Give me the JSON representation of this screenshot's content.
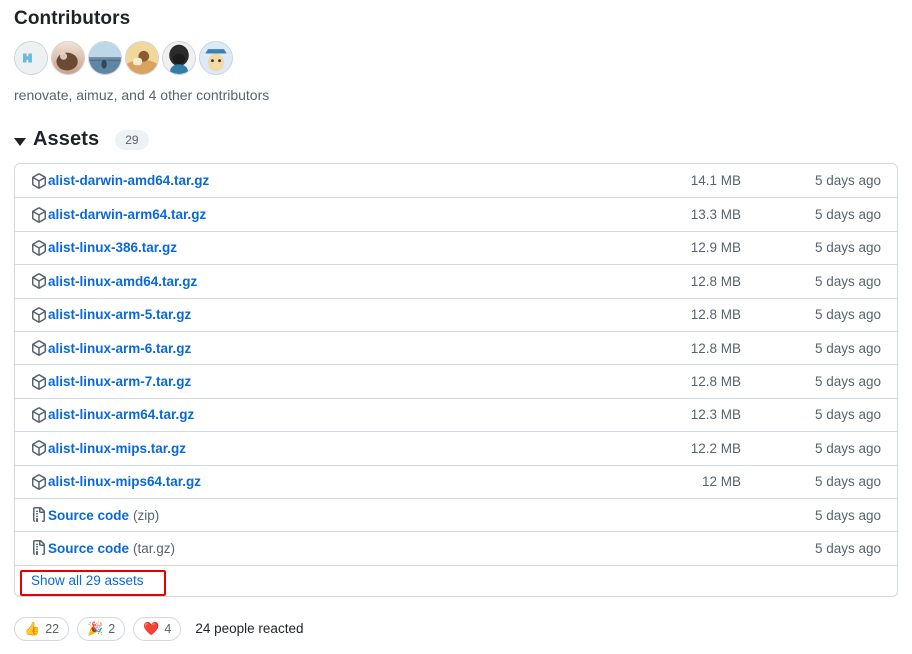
{
  "contributors": {
    "heading": "Contributors",
    "summary": "renovate, aimuz, and 4 other contributors",
    "avatars": [
      {
        "name": "avatar-renovate",
        "type": "logo-mark",
        "bg": "#eef1f4",
        "fg": "#6cb8d6"
      },
      {
        "name": "avatar-aimuz",
        "type": "photo-warm",
        "c1": "#6b4a35",
        "c2": "#c9a089",
        "c3": "#f1e2d4"
      },
      {
        "name": "avatar-contributor-3",
        "type": "photo-sea",
        "c1": "#bcd8e8",
        "c2": "#5f86a3",
        "c3": "#2e4a5e"
      },
      {
        "name": "avatar-contributor-4",
        "type": "photo-sand",
        "c1": "#f2d79a",
        "c2": "#d9a25e",
        "c3": "#8a5a33"
      },
      {
        "name": "avatar-contributor-5",
        "type": "photo-dark",
        "c1": "#2b2b2b",
        "c2": "#1c1c1c",
        "c3": "#2f7fa8"
      },
      {
        "name": "avatar-contributor-6",
        "type": "illustration",
        "c1": "#dbeaf6",
        "c2": "#f3d9a4",
        "c3": "#3b7fb5"
      }
    ]
  },
  "assets": {
    "title": "Assets",
    "count": "29",
    "expanded": true,
    "show_all_label": "Show all 29 assets",
    "rows": [
      {
        "icon": "package-icon",
        "name": "alist-darwin-amd64.tar.gz",
        "suffix": "",
        "size": "14.1 MB",
        "date": "5 days ago"
      },
      {
        "icon": "package-icon",
        "name": "alist-darwin-arm64.tar.gz",
        "suffix": "",
        "size": "13.3 MB",
        "date": "5 days ago"
      },
      {
        "icon": "package-icon",
        "name": "alist-linux-386.tar.gz",
        "suffix": "",
        "size": "12.9 MB",
        "date": "5 days ago"
      },
      {
        "icon": "package-icon",
        "name": "alist-linux-amd64.tar.gz",
        "suffix": "",
        "size": "12.8 MB",
        "date": "5 days ago"
      },
      {
        "icon": "package-icon",
        "name": "alist-linux-arm-5.tar.gz",
        "suffix": "",
        "size": "12.8 MB",
        "date": "5 days ago"
      },
      {
        "icon": "package-icon",
        "name": "alist-linux-arm-6.tar.gz",
        "suffix": "",
        "size": "12.8 MB",
        "date": "5 days ago"
      },
      {
        "icon": "package-icon",
        "name": "alist-linux-arm-7.tar.gz",
        "suffix": "",
        "size": "12.8 MB",
        "date": "5 days ago"
      },
      {
        "icon": "package-icon",
        "name": "alist-linux-arm64.tar.gz",
        "suffix": "",
        "size": "12.3 MB",
        "date": "5 days ago"
      },
      {
        "icon": "package-icon",
        "name": "alist-linux-mips.tar.gz",
        "suffix": "",
        "size": "12.2 MB",
        "date": "5 days ago"
      },
      {
        "icon": "package-icon",
        "name": "alist-linux-mips64.tar.gz",
        "suffix": "",
        "size": "12 MB",
        "date": "5 days ago"
      },
      {
        "icon": "file-zip-icon",
        "name": "Source code",
        "suffix": "(zip)",
        "size": "",
        "date": "5 days ago"
      },
      {
        "icon": "file-zip-icon",
        "name": "Source code",
        "suffix": "(tar.gz)",
        "size": "",
        "date": "5 days ago"
      }
    ]
  },
  "reactions": {
    "items": [
      {
        "name": "reaction-thumbs-up",
        "emoji": "👍",
        "count": "22"
      },
      {
        "name": "reaction-hooray",
        "emoji": "🎉",
        "count": "2"
      },
      {
        "name": "reaction-heart",
        "emoji": "❤️",
        "count": "4"
      }
    ],
    "summary": "24 people reacted"
  },
  "colors": {
    "link": "#0969da",
    "muted": "#59636e",
    "border": "#d1d9e0",
    "annotation": "#e60000"
  }
}
